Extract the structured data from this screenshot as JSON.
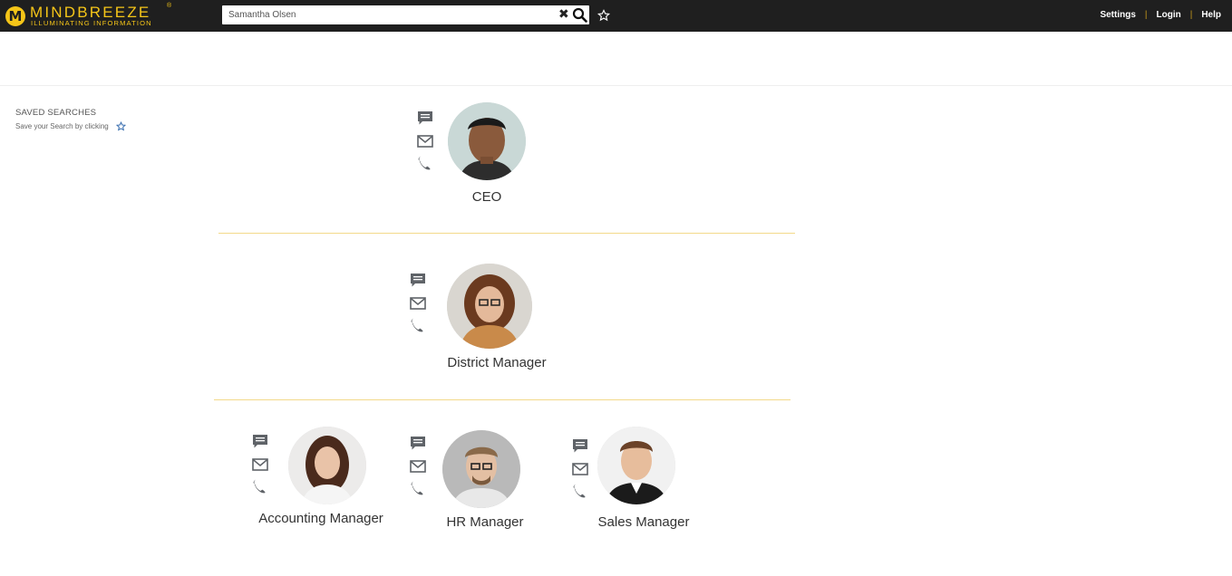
{
  "header": {
    "logo_name": "MINDBREEZE",
    "logo_tagline": "ILLUMINATING INFORMATION",
    "logo_mark": "M",
    "logo_reg": "®",
    "search_value": "Samantha Olsen",
    "clear_glyph": "✖",
    "links": {
      "settings": "Settings",
      "login": "Login",
      "help": "Help"
    },
    "separator": "|",
    "accent_color": "#f5c518"
  },
  "sidebar": {
    "title": "SAVED SEARCHES",
    "subtitle": "Save your Search by clicking"
  },
  "org_chart": {
    "people": [
      {
        "role": "CEO"
      },
      {
        "role": "District Manager"
      },
      {
        "role": "Accounting Manager"
      },
      {
        "role": "HR Manager"
      },
      {
        "role": "Sales Manager"
      }
    ],
    "contact_icons": [
      "chat-icon",
      "mail-icon",
      "phone-icon"
    ]
  }
}
